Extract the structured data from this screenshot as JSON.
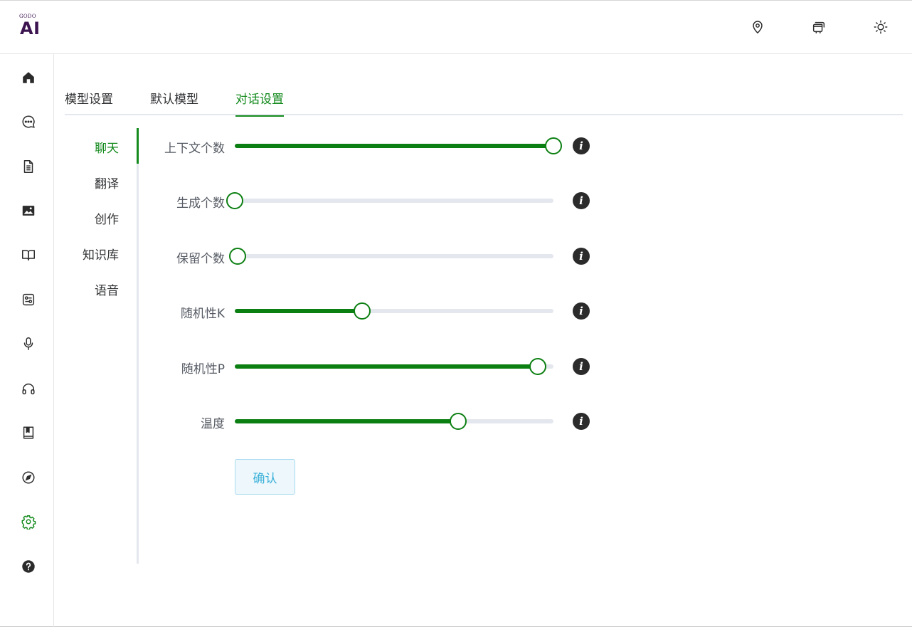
{
  "app": {
    "logo_small": "GODO",
    "logo_big": "AI"
  },
  "header": {
    "icons": [
      "location-icon",
      "cards-icon",
      "sun-icon"
    ]
  },
  "rail": {
    "items": [
      {
        "icon": "home-icon"
      },
      {
        "icon": "chat-icon"
      },
      {
        "icon": "document-icon"
      },
      {
        "icon": "image-icon"
      },
      {
        "icon": "book-open-icon"
      },
      {
        "icon": "tools-icon"
      },
      {
        "icon": "microphone-icon"
      },
      {
        "icon": "headphones-icon"
      },
      {
        "icon": "bookmark-book-icon"
      },
      {
        "icon": "compass-icon"
      },
      {
        "icon": "gear-icon",
        "active": true
      },
      {
        "icon": "help-icon"
      }
    ]
  },
  "tabs": [
    {
      "label": "模型设置"
    },
    {
      "label": "默认模型"
    },
    {
      "label": "对话设置",
      "active": true
    }
  ],
  "vnav": [
    {
      "label": "聊天",
      "active": true
    },
    {
      "label": "翻译"
    },
    {
      "label": "创作"
    },
    {
      "label": "知识库"
    },
    {
      "label": "语音"
    }
  ],
  "settings": [
    {
      "label": "上下文个数",
      "fraction": 1.0
    },
    {
      "label": "生成个数",
      "fraction": 0.0
    },
    {
      "label": "保留个数",
      "fraction": 0.01
    },
    {
      "label": "随机性K",
      "fraction": 0.4
    },
    {
      "label": "随机性P",
      "fraction": 0.95
    },
    {
      "label": "温度",
      "fraction": 0.7
    }
  ],
  "confirm_label": "确认",
  "colors": {
    "accent": "#138a1c",
    "slider_fill": "#0c7f12",
    "track": "#e4e7ed",
    "logo": "#3c1450",
    "button_text": "#3ab0d8"
  }
}
